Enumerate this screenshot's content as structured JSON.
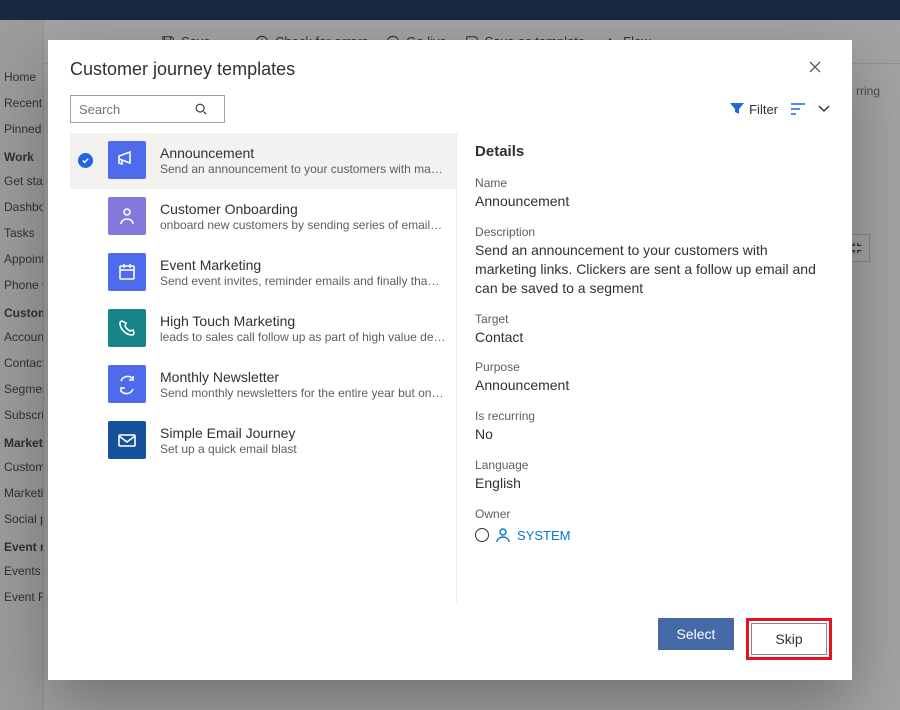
{
  "bg": {
    "cmdbar": {
      "save": "Save",
      "check": "Check for errors",
      "golive": "Go live",
      "saveastemplate": "Save as template",
      "flow": "Flow"
    },
    "sidebar": {
      "items_1": [
        "Home",
        "Recent",
        "Pinned"
      ],
      "head1": "Work",
      "items_2": [
        "Get started",
        "Dashboards",
        "Tasks",
        "Appointments",
        "Phone Calls"
      ],
      "head2": "Customers",
      "items_3": [
        "Accounts",
        "Contacts",
        "Segments",
        "Subscriptions"
      ],
      "head3": "Marketing execution",
      "items_4": [
        "Customer journeys",
        "Marketing emails",
        "Social posts"
      ],
      "head4": "Event management",
      "items_5": [
        "Events",
        "Event Registrations"
      ]
    },
    "sub_right": "rring"
  },
  "modal": {
    "title": "Customer journey templates",
    "search_placeholder": "Search",
    "filter_label": "Filter"
  },
  "templates": [
    {
      "name": "Announcement",
      "desc": "Send an announcement to your customers with marketing links. Clickers are sent a…",
      "color": "#4f6bed",
      "icon": "megaphone",
      "selected": true
    },
    {
      "name": "Customer Onboarding",
      "desc": "onboard new customers by sending series of emails at regular cadence",
      "color": "#8378de",
      "icon": "person"
    },
    {
      "name": "Event Marketing",
      "desc": "Send event invites, reminder emails and finally thank you on attending",
      "color": "#4f6bed",
      "icon": "calendar"
    },
    {
      "name": "High Touch Marketing",
      "desc": "leads to sales call follow up as part of high value deals",
      "color": "#168387",
      "icon": "phone"
    },
    {
      "name": "Monthly Newsletter",
      "desc": "Send monthly newsletters for the entire year but only on weekday afternoons",
      "color": "#4f6bed",
      "icon": "refresh"
    },
    {
      "name": "Simple Email Journey",
      "desc": "Set up a quick email blast",
      "color": "#17509b",
      "icon": "mail"
    }
  ],
  "details": {
    "heading": "Details",
    "fields": {
      "name_label": "Name",
      "name_value": "Announcement",
      "description_label": "Description",
      "description_value": "Send an announcement to your customers with marketing links. Clickers are sent a follow up email and can be saved to a segment",
      "target_label": "Target",
      "target_value": "Contact",
      "purpose_label": "Purpose",
      "purpose_value": "Announcement",
      "recurring_label": "Is recurring",
      "recurring_value": "No",
      "language_label": "Language",
      "language_value": "English",
      "owner_label": "Owner",
      "owner_value": "SYSTEM"
    }
  },
  "footer": {
    "select": "Select",
    "skip": "Skip"
  }
}
